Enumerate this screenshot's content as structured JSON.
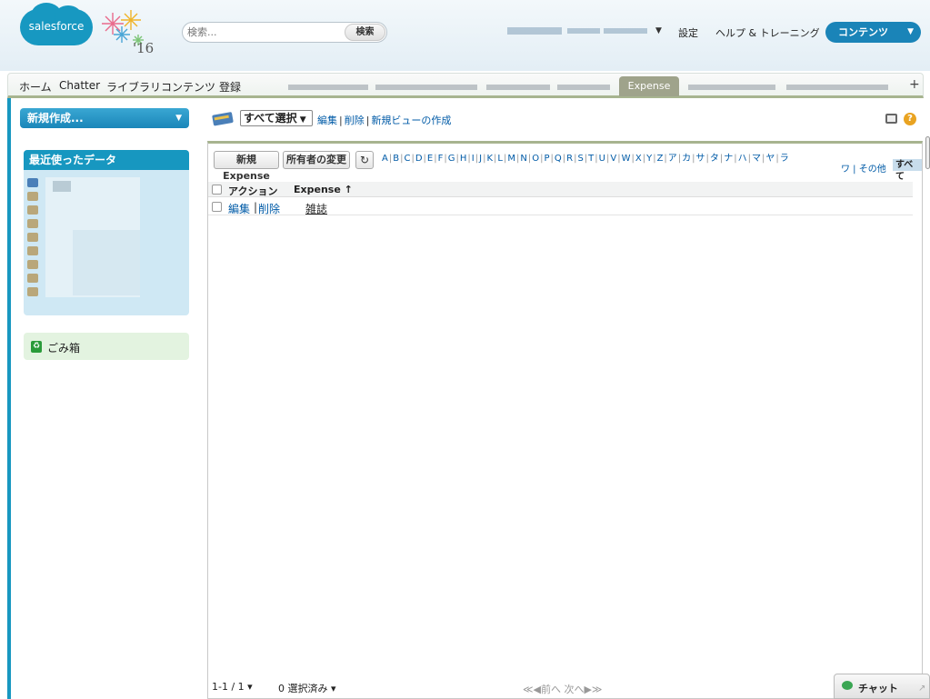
{
  "header": {
    "logo_text": "salesforce",
    "logo_year": "'16",
    "search": {
      "placeholder": "検索...",
      "button": "検索"
    },
    "user_caret": "▼",
    "links": {
      "setup": "設定",
      "help": "ヘルプ & トレーニング"
    },
    "app_menu": {
      "label": "コンテンツ",
      "caret": "▼"
    }
  },
  "tabs": {
    "items": [
      "ホーム",
      "Chatter",
      "ライブラリ",
      "コンテンツ",
      "登録"
    ],
    "active": "Expense",
    "plus": "+"
  },
  "sidebar": {
    "create_new": "新規作成...",
    "create_caret": "▼",
    "recent_title": "最近使ったデータ",
    "trash_label": "ごみ箱"
  },
  "main": {
    "view_select": "すべて選択",
    "view_caret": "▼",
    "view_links": {
      "edit": "編集",
      "delete": "削除",
      "new_view": "新規ビューの作成"
    },
    "buttons": {
      "new": "新規Expense",
      "change_owner": "所有者の変更",
      "refresh": "↻"
    },
    "alphabet": [
      "A",
      "B",
      "C",
      "D",
      "E",
      "F",
      "G",
      "H",
      "I",
      "J",
      "K",
      "L",
      "M",
      "N",
      "O",
      "P",
      "Q",
      "R",
      "S",
      "T",
      "U",
      "V",
      "W",
      "X",
      "Y",
      "Z",
      "ア",
      "カ",
      "サ",
      "タ",
      "ナ",
      "ハ",
      "マ",
      "ヤ",
      "ラ"
    ],
    "alphabet_row2": "ワ | その他",
    "alphabet_all": "すべて",
    "table": {
      "columns": [
        "アクション",
        "Expense ↑"
      ],
      "rows": [
        {
          "edit": "編集",
          "sep": "|",
          "delete": "削除",
          "name": "雑誌"
        }
      ]
    },
    "pager": {
      "range": "1-1 / 1",
      "selected": "0 選択済み",
      "nav": "≪◀前へ 次へ▶≫"
    }
  },
  "chat": {
    "label": "チャット",
    "expand": "↗"
  }
}
